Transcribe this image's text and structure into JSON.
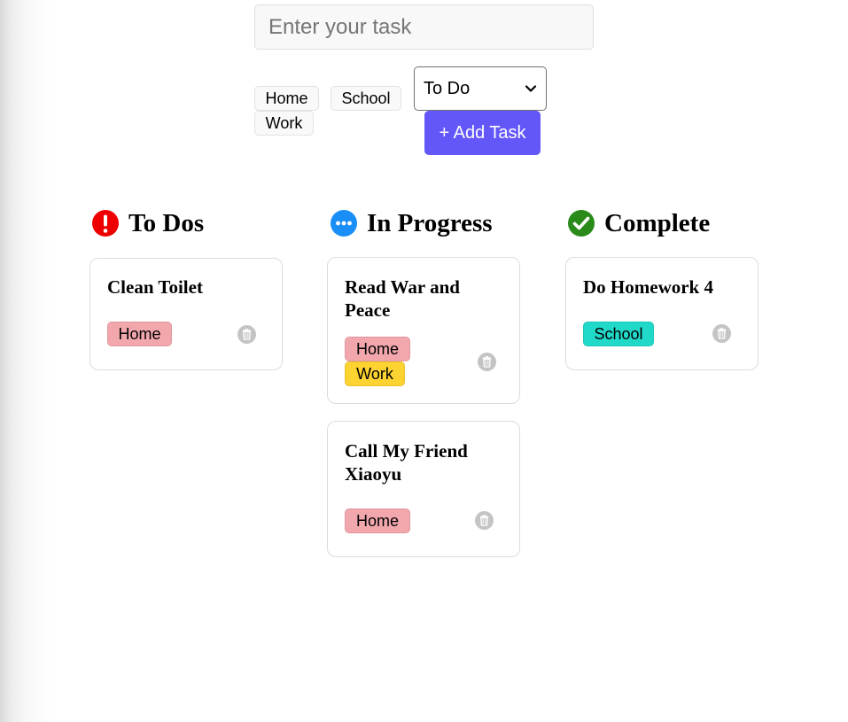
{
  "form": {
    "task_placeholder": "Enter your task",
    "tags": [
      "Home",
      "School",
      "Work"
    ],
    "status_value": "To Do",
    "add_label": "+ Add Task"
  },
  "colors": {
    "accent": "#6457f9",
    "todo_icon": "#ee0000",
    "progress_icon": "#1a8ef7",
    "complete_icon": "#2a8a1a",
    "tag_home": "#f2a7ad",
    "tag_work": "#fdd331",
    "tag_school": "#20d9c9",
    "trash": "#c4c4c4"
  },
  "columns": [
    {
      "title": "To Dos",
      "icon": "exclamation-circle-icon",
      "cards": [
        {
          "title": "Clean Toilet",
          "tags": [
            "Home"
          ]
        }
      ]
    },
    {
      "title": "In Progress",
      "icon": "ellipsis-circle-icon",
      "cards": [
        {
          "title": "Read War and Peace",
          "tags": [
            "Home",
            "Work"
          ]
        },
        {
          "title": "Call My Friend Xiaoyu",
          "tags": [
            "Home"
          ]
        }
      ]
    },
    {
      "title": "Complete",
      "icon": "check-circle-icon",
      "cards": [
        {
          "title": "Do Homework 4",
          "tags": [
            "School"
          ]
        }
      ]
    }
  ]
}
